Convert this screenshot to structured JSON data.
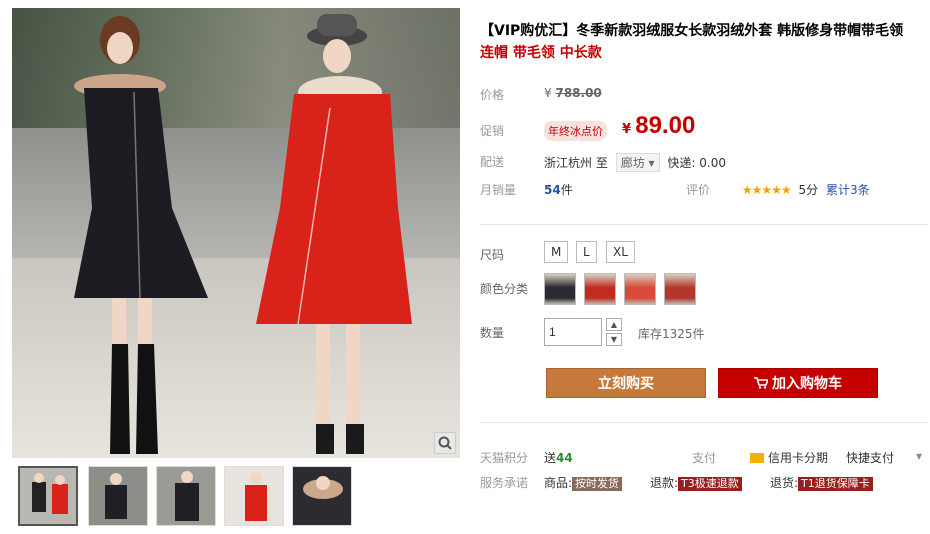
{
  "product": {
    "title_main": "【VIP购优汇】冬季新款羽绒服女长款羽绒外套 韩版修身带帽带毛领",
    "title_sub": "连帽 带毛领 中长款"
  },
  "price": {
    "label": "价格",
    "currency": "¥",
    "original": "788.00"
  },
  "promo": {
    "label": "促销",
    "tag": "年终冰点价",
    "currency": "¥",
    "price": "89.00"
  },
  "shipping": {
    "label": "配送",
    "from": "浙江杭州",
    "to_word": "至",
    "dest": "廊坊",
    "dest_arrow": "▾",
    "fee": "快递: 0.00"
  },
  "sales": {
    "label": "月销量",
    "count": "54",
    "unit": "件"
  },
  "rating": {
    "label": "评价",
    "stars": "★★★★★",
    "score": "5分",
    "reviews": "累计3条"
  },
  "size": {
    "label": "尺码",
    "options": [
      "M",
      "L",
      "XL"
    ]
  },
  "color": {
    "label": "颜色分类",
    "swatches": [
      "#2a2a33",
      "#c22b20",
      "#d94a3a",
      "#b4362a"
    ]
  },
  "quantity": {
    "label": "数量",
    "value": "1",
    "up": "▲",
    "down": "▼",
    "stock": "库存1325件"
  },
  "actions": {
    "buy": "立刻购买",
    "cart": "加入购物车"
  },
  "points": {
    "label": "天猫积分",
    "text": "送",
    "value": "44",
    "pay_label": "支付",
    "credit": "信用卡分期",
    "quick": "快捷支付",
    "more_arrow": "▾"
  },
  "service": {
    "label": "服务承诺",
    "goods_label": "商品:",
    "goods_tag": "按时发货",
    "refund_label": "退款:",
    "refund_tag": "T3极速退款",
    "return_label": "退货:",
    "return_tag": "T1退货保障卡"
  },
  "colors": {
    "accent_red": "#c40000",
    "buy_brown": "#c57a3b"
  }
}
